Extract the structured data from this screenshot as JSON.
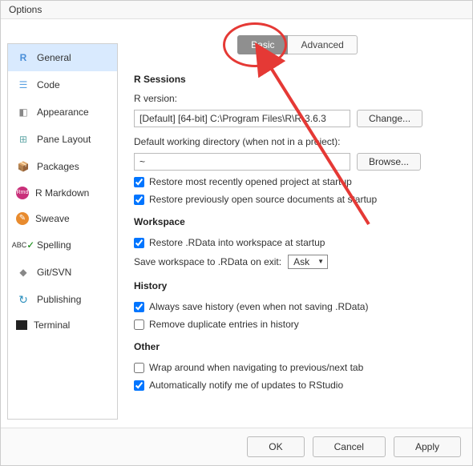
{
  "window": {
    "title": "Options"
  },
  "sidebar": {
    "items": [
      {
        "label": "General"
      },
      {
        "label": "Code"
      },
      {
        "label": "Appearance"
      },
      {
        "label": "Pane Layout"
      },
      {
        "label": "Packages"
      },
      {
        "label": "R Markdown"
      },
      {
        "label": "Sweave"
      },
      {
        "label": "Spelling"
      },
      {
        "label": "Git/SVN"
      },
      {
        "label": "Publishing"
      },
      {
        "label": "Terminal"
      }
    ]
  },
  "tabs": {
    "basic": "Basic",
    "advanced": "Advanced"
  },
  "sections": {
    "rsessions": {
      "title": "R Sessions",
      "version_label": "R version:",
      "version_value": "[Default] [64-bit] C:\\Program Files\\R\\R-3.6.3",
      "change": "Change...",
      "wd_label": "Default working directory (when not in a project):",
      "wd_value": "~",
      "browse": "Browse...",
      "restore_project": "Restore most recently opened project at startup",
      "restore_docs": "Restore previously open source documents at startup"
    },
    "workspace": {
      "title": "Workspace",
      "restore_rdata": "Restore .RData into workspace at startup",
      "save_label": "Save workspace to .RData on exit:",
      "save_value": "Ask"
    },
    "history": {
      "title": "History",
      "always_save": "Always save history (even when not saving .RData)",
      "remove_dupes": "Remove duplicate entries in history"
    },
    "other": {
      "title": "Other",
      "wrap": "Wrap around when navigating to previous/next tab",
      "notify": "Automatically notify me of updates to RStudio"
    }
  },
  "footer": {
    "ok": "OK",
    "cancel": "Cancel",
    "apply": "Apply"
  }
}
